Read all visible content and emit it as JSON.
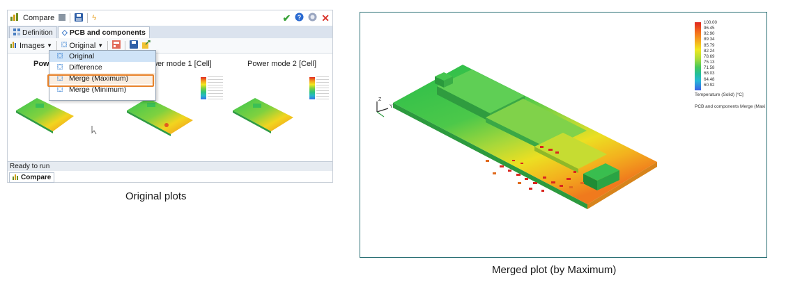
{
  "app": {
    "title": "Compare",
    "tabs": [
      {
        "label": "Definition"
      },
      {
        "label": "PCB and components"
      }
    ],
    "toolbar": {
      "images_label": "Images",
      "view_label": "Original"
    },
    "plot_titles": [
      "Power",
      "ower mode 1 [Cell]",
      "Power mode 2 [Cell]"
    ],
    "view_menu": [
      {
        "label": "Original"
      },
      {
        "label": "Difference"
      },
      {
        "label": "Merge (Maximum)"
      },
      {
        "label": "Merge (Minimum)"
      }
    ],
    "status": "Ready to run",
    "bottom_tab": "Compare"
  },
  "captions": {
    "left": "Original plots",
    "right": "Merged plot (by Maximum)"
  },
  "legend": {
    "values": [
      "100.00",
      "96.45",
      "92.90",
      "89.34",
      "85.79",
      "82.24",
      "78.69",
      "75.13",
      "71.58",
      "68.03",
      "64.48",
      "60.92"
    ],
    "quantity": "Temperature (Solid) [°C]",
    "plot_name": "PCB and components Merge (Maxi",
    "axes": {
      "z": "Z",
      "y": "Y"
    }
  },
  "colors": {
    "accent_orange": "#e8822a",
    "check_green": "#3aa33a",
    "close_red": "#d9342b",
    "frame": "#2a6f74"
  }
}
